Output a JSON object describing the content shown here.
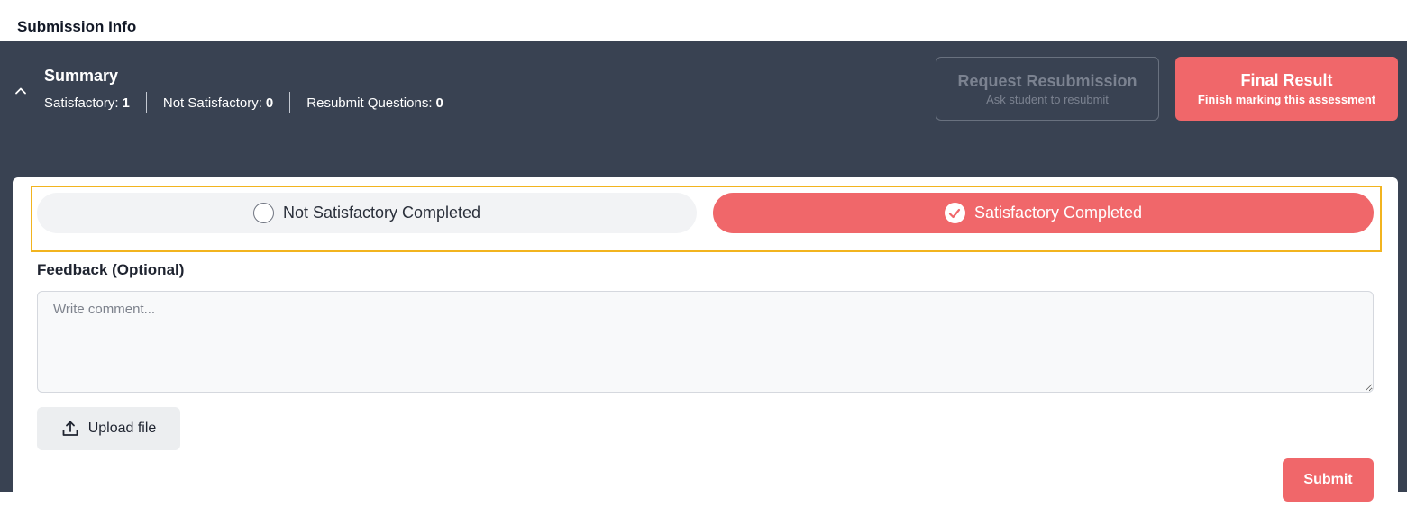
{
  "page_title": "Submission Info",
  "summary": {
    "title": "Summary",
    "stats": [
      {
        "label": "Satisfactory:",
        "value": "1"
      },
      {
        "label": "Not Satisfactory:",
        "value": "0"
      },
      {
        "label": "Resubmit Questions:",
        "value": "0"
      }
    ]
  },
  "actions": {
    "resubmission": {
      "title": "Request Resubmission",
      "subtitle": "Ask student to resubmit"
    },
    "final_result": {
      "title": "Final Result",
      "subtitle": "Finish marking this assessment"
    }
  },
  "outcome": {
    "not_satisfactory_label": "Not Satisfactory Completed",
    "satisfactory_label": "Satisfactory Completed",
    "selected": "satisfactory"
  },
  "feedback": {
    "label": "Feedback (Optional)",
    "placeholder": "Write comment...",
    "value": ""
  },
  "upload": {
    "label": "Upload file",
    "icon": "upload-icon"
  },
  "submit": {
    "label": "Submit"
  },
  "colors": {
    "panel_bg": "#394252",
    "accent": "#f0676a",
    "highlight_border": "#f2b41f"
  }
}
